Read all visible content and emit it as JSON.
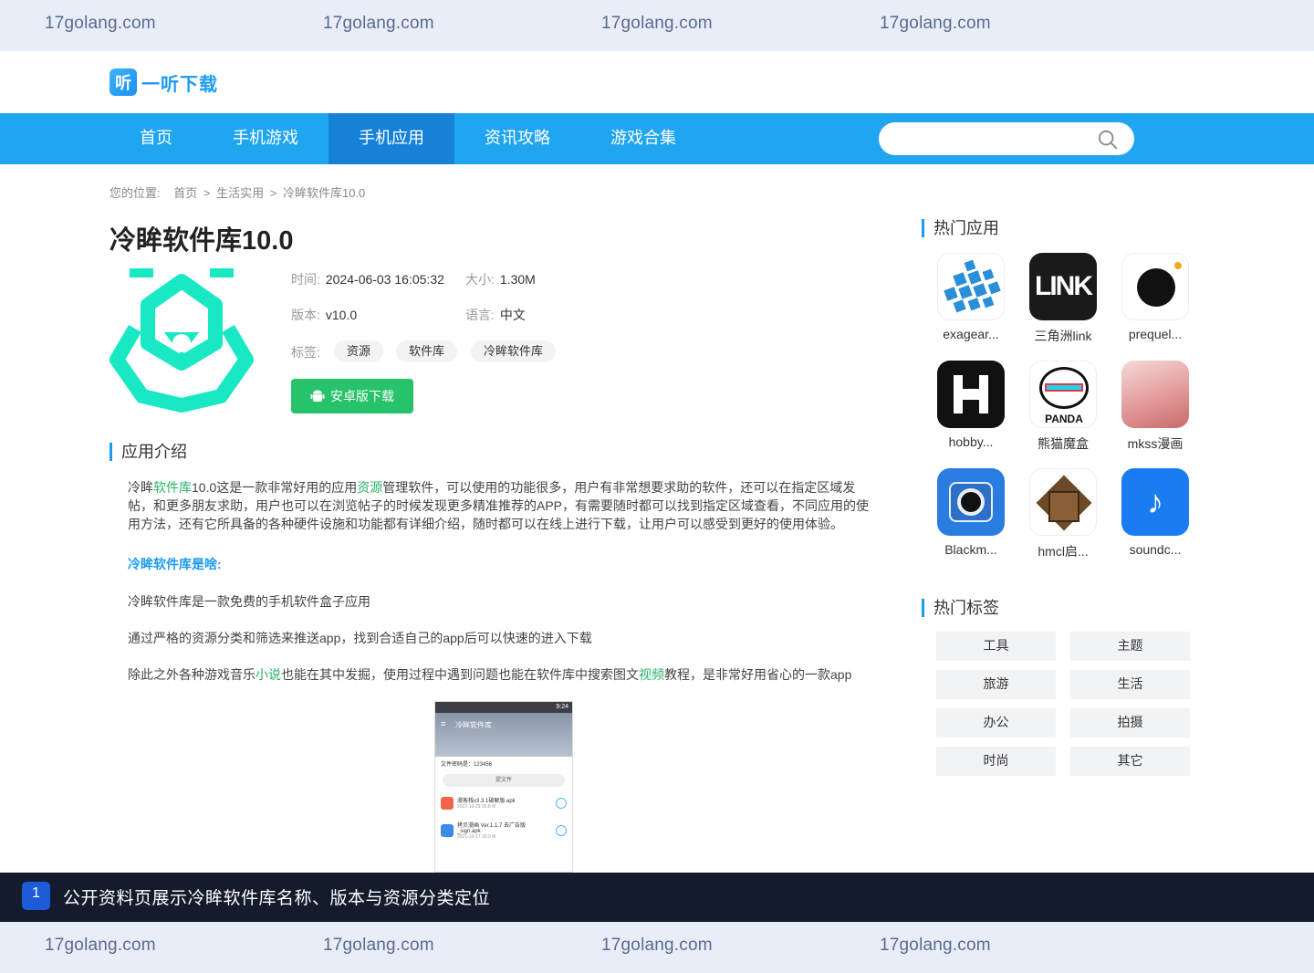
{
  "watermark": {
    "text": "17golang.com"
  },
  "header": {
    "logo_mark": "听",
    "logo_text": "一听下载"
  },
  "nav": {
    "items": [
      "首页",
      "手机游戏",
      "手机应用",
      "资讯攻略",
      "游戏合集"
    ],
    "active": "手机应用",
    "search_placeholder": ""
  },
  "breadcrumb": {
    "label": "您的位置:",
    "home": "首页",
    "sep": ">",
    "category": "生活实用",
    "current": "冷眸软件库10.0"
  },
  "app": {
    "title": "冷眸软件库10.0",
    "time_label": "时间:",
    "time": "2024-06-03 16:05:32",
    "size_label": "大小:",
    "size": "1.30M",
    "version_label": "版本:",
    "version": "v10.0",
    "lang_label": "语言:",
    "lang": "中文",
    "tags_label": "标签:",
    "tags": [
      "资源",
      "软件库",
      "冷眸软件库"
    ],
    "download_label": "安卓版下载",
    "icon_color": "#19e8c4"
  },
  "intro": {
    "heading": "应用介绍",
    "p1_a": "冷眸",
    "p1_hl1": "软件库",
    "p1_b": "10.0这是一款非常好用的应用",
    "p1_hl2": "资源",
    "p1_c": "管理软件，可以使用的功能很多，用户有非常想要求助的软件，还可以在指定区域发帖，和更多朋友求助，用户也可以在浏览帖子的时候发现更多精准推荐的APP，有需要随时都可以找到指定区域查看，不同应用的使用方法，还有它所具备的各种硬件设施和功能都有详细介绍，随时都可以在线上进行下载，让用户可以感受到更好的使用体验。",
    "question": "冷眸软件库是啥:",
    "line1": "冷眸软件库是一款免费的手机软件盒子应用",
    "line2": "通过严格的资源分类和筛选来推送app，找到合适自己的app后可以快速的进入下载",
    "line3_a": "除此之外各种游戏音乐",
    "line3_hl1": "小说",
    "line3_b": "也能在其中发掘，使用过程中遇到问题也能在软件库中搜索图文",
    "line3_hl2": "视频",
    "line3_c": "教程，是非常好用省心的一款app"
  },
  "preview": {
    "status": "9:24",
    "app_name": "冷眸软件库",
    "code_row": "文件密码是：123456",
    "btn": "提文件",
    "file1": "漫客栈v3.3.1破解版.apk",
    "file1_meta": "2021-10-29  25.8 M",
    "file2": "拷贝漫画 Ver.1.1.7 去广告版_sign.apk",
    "file2_meta": "2021-10-17  20.9 M"
  },
  "sidebar": {
    "hot_apps_title": "热门应用",
    "apps": [
      {
        "name": "exagear...",
        "icon": "exagear-icon"
      },
      {
        "name": "三角洲link",
        "icon": "link-icon"
      },
      {
        "name": "prequel...",
        "icon": "prequel-icon"
      },
      {
        "name": "hobby...",
        "icon": "hobby-icon"
      },
      {
        "name": "熊猫魔盒",
        "icon": "panda-icon"
      },
      {
        "name": "mkss漫画",
        "icon": "mkss-icon"
      },
      {
        "name": "Blackm...",
        "icon": "camera-icon"
      },
      {
        "name": "hmcl启...",
        "icon": "chest-icon"
      },
      {
        "name": "soundc...",
        "icon": "music-icon"
      }
    ],
    "hot_tags_title": "热门标签",
    "tags": [
      "工具",
      "主题",
      "旅游",
      "生活",
      "办公",
      "拍摄",
      "时尚",
      "其它"
    ]
  },
  "banner": {
    "num": "1",
    "text": "公开资料页展示冷眸软件库名称、版本与资源分类定位"
  }
}
